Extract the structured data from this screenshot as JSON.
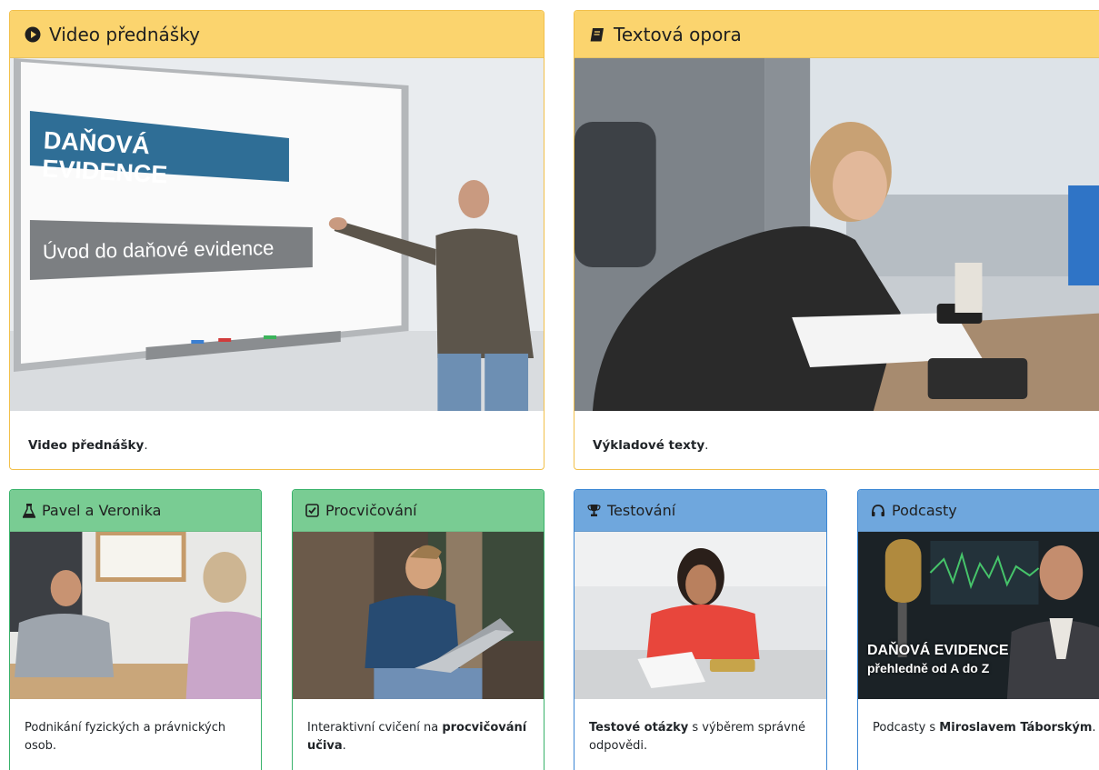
{
  "cards": [
    {
      "id": "video",
      "icon": "play-circle-icon",
      "title": "Video přednášky",
      "image": {
        "alt_scene": "whiteboard-lecture",
        "overlay_title": "DAŇOVÁ EVIDENCE",
        "overlay_subtitle": "Úvod do daňové evidence"
      },
      "desc_bold": "Video přednášky",
      "desc_after": "."
    },
    {
      "id": "text",
      "icon": "book-icon",
      "title": "Textová opora",
      "image": {
        "alt_scene": "woman-reading-documents"
      },
      "desc_bold": "Výkladové texty",
      "desc_after": "."
    },
    {
      "id": "pavel",
      "icon": "flask-icon",
      "title": "Pavel a Veronika",
      "image": {
        "alt_scene": "office-consultation"
      },
      "desc_before": "Podnikání fyzických a právnických osob."
    },
    {
      "id": "practice",
      "icon": "check-square-icon",
      "title": "Procvičování",
      "image": {
        "alt_scene": "student-with-laptop"
      },
      "desc_before": "Interaktivní cvičení na ",
      "desc_bold": "procvičování učiva",
      "desc_after": "."
    },
    {
      "id": "testing",
      "icon": "trophy-icon",
      "title": "Testování",
      "image": {
        "alt_scene": "student-writing-test"
      },
      "desc_bold": "Testové otázky",
      "desc_after": " s výběrem správné odpovědi."
    },
    {
      "id": "podcasts",
      "icon": "headphones-icon",
      "title": "Podcasty",
      "image": {
        "alt_scene": "podcast-microphone",
        "overlay_title": "DAŇOVÁ EVIDENCE",
        "overlay_subtitle": "přehledně od A do Z"
      },
      "desc_before": "Podcasty s ",
      "desc_bold": "Miroslavem Táborským",
      "desc_after": "."
    }
  ],
  "colors": {
    "yellow_header": "#fbd46e",
    "yellow_border": "#f2c04a",
    "green_header": "#79cc93",
    "green_border": "#38b26a",
    "blue_header": "#6fa7dd",
    "blue_border": "#3a86d4"
  }
}
